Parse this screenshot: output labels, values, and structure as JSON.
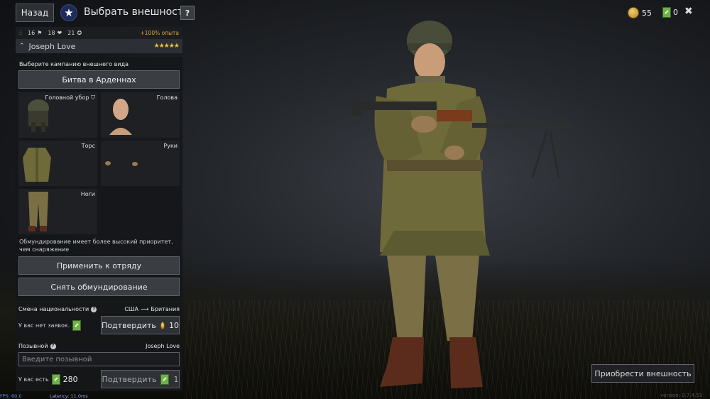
{
  "header": {
    "back_label": "Назад",
    "title": "Выбрать внешность",
    "help_label": "?"
  },
  "currency": {
    "gold": "55",
    "tickets": "0"
  },
  "squad": {
    "stat1": "16",
    "stat2": "18",
    "stat3": "21",
    "bonus": "+100% опыта",
    "name": "Joseph Love",
    "stars": "★★★★★"
  },
  "appearance": {
    "campaign_prompt": "Выберите кампанию внешнего вида",
    "campaign": "Битва в Арденнах",
    "slots": {
      "headgear": "Головной убор",
      "head": "Голова",
      "torso": "Торс",
      "hands": "Руки",
      "legs": "Ноги"
    },
    "note": "Обмундирование имеет более высокий приоритет, чем снаряжение",
    "apply_label": "Применить к отряду",
    "remove_label": "Снять обмундирование"
  },
  "nationality": {
    "title": "Смена национальности",
    "from": "США",
    "to": "Британия",
    "no_requests": "У вас нет заявок.",
    "confirm_label": "Подтвердить",
    "cost": "10"
  },
  "callsign": {
    "title": "Позывной",
    "current": "Joseph Love",
    "placeholder": "Введите позывной",
    "have_label": "У вас есть",
    "have_count": "280",
    "confirm_label": "Подтвердить",
    "cost": "1"
  },
  "footer": {
    "buy_label": "Приобрести внешность",
    "fps": "FPS: 60.0",
    "latency": "Latency: 11.0ms",
    "version": "version: 0.7.4.53"
  },
  "colors": {
    "accent_gold": "#e0a832",
    "star": "#f0c23a",
    "ticket_green": "#6fb04a"
  }
}
